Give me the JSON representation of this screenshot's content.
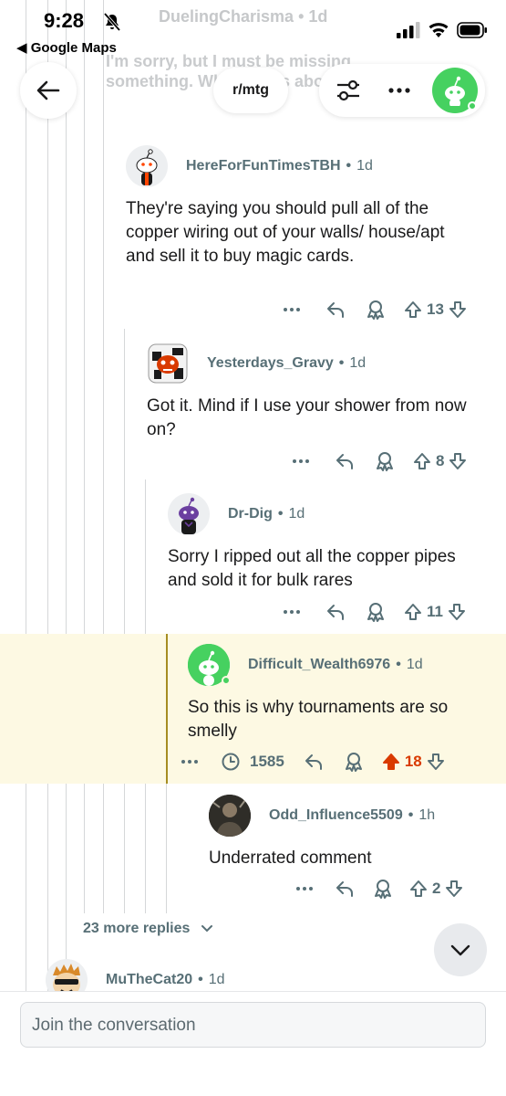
{
  "status_bar": {
    "time": "9:28",
    "back_app": "◀ Google Maps"
  },
  "parent_ghost": {
    "username": "DuelingCharisma",
    "age": "1d",
    "text": "I'm sorry, but I must be missing something. What is this about copper?"
  },
  "top_bar": {
    "subreddit": "r/mtg"
  },
  "comments": [
    {
      "username": "HereForFunTimesTBH",
      "age": "1d",
      "text": "They're saying you should pull all of the copper wiring out of your walls/ house/apt and sell it to buy magic cards.",
      "votes": "13"
    },
    {
      "username": "Yesterdays_Gravy",
      "age": "1d",
      "text": "Got it. Mind if I use your shower from now on?",
      "votes": "8"
    },
    {
      "username": "Dr-Dig",
      "age": "1d",
      "text": "Sorry I ripped out all the copper pipes and sold it for bulk rares",
      "votes": "11"
    },
    {
      "username": "Difficult_Wealth6976",
      "age": "1d",
      "text": "So this is why tournaments are so smelly",
      "views": "1585",
      "votes": "18",
      "upvote_color": "#d93a00"
    },
    {
      "username": "Odd_Influence5509",
      "age": "1h",
      "text": "Underrated comment",
      "votes": "2"
    }
  ],
  "more_replies": "23 more replies",
  "next_comment": {
    "username": "MuTheCat20",
    "age": "1d"
  },
  "composer": {
    "placeholder": "Join the conversation"
  },
  "colors": {
    "accent_green": "#46d160",
    "highlight": "#fdf9e3",
    "meta_text": "#576f76"
  }
}
